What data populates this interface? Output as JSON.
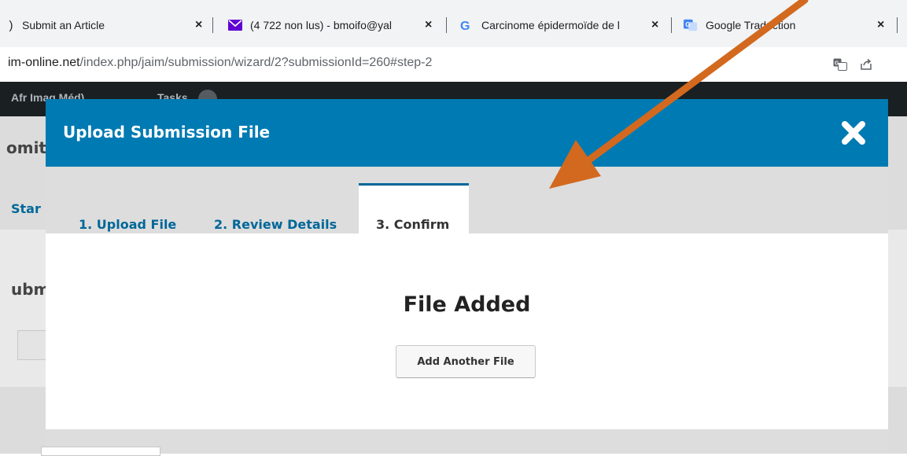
{
  "browser": {
    "tabs": [
      {
        "title": "Submit an Article",
        "favicon": "page-icon"
      },
      {
        "title": "(4 722 non lus) - bmoifo@yal",
        "favicon": "mail-icon"
      },
      {
        "title": "Carcinome épidermoïde de l",
        "favicon": "google-icon"
      },
      {
        "title": "Google Traduction",
        "favicon": "translate-icon"
      }
    ],
    "close_glyph": "×",
    "url_host": "im-online.net",
    "url_path": "/index.php/jaim/submission/wizard/2?submissionId=260#step-2"
  },
  "background_page": {
    "nav_title": "Afr Imag Méd)",
    "nav_tasks": "Tasks",
    "frag_title": "omit",
    "frag_tab": "Star",
    "frag_section": "ubm"
  },
  "modal": {
    "title": "Upload Submission File",
    "close_glyph": "✖",
    "tabs": [
      {
        "label": "1. Upload File"
      },
      {
        "label": "2. Review Details"
      },
      {
        "label": "3. Confirm"
      }
    ],
    "heading": "File Added",
    "add_button": "Add Another File"
  },
  "colors": {
    "header": "#007ab2",
    "tab_link": "#006798",
    "arrow": "#d2691e"
  }
}
